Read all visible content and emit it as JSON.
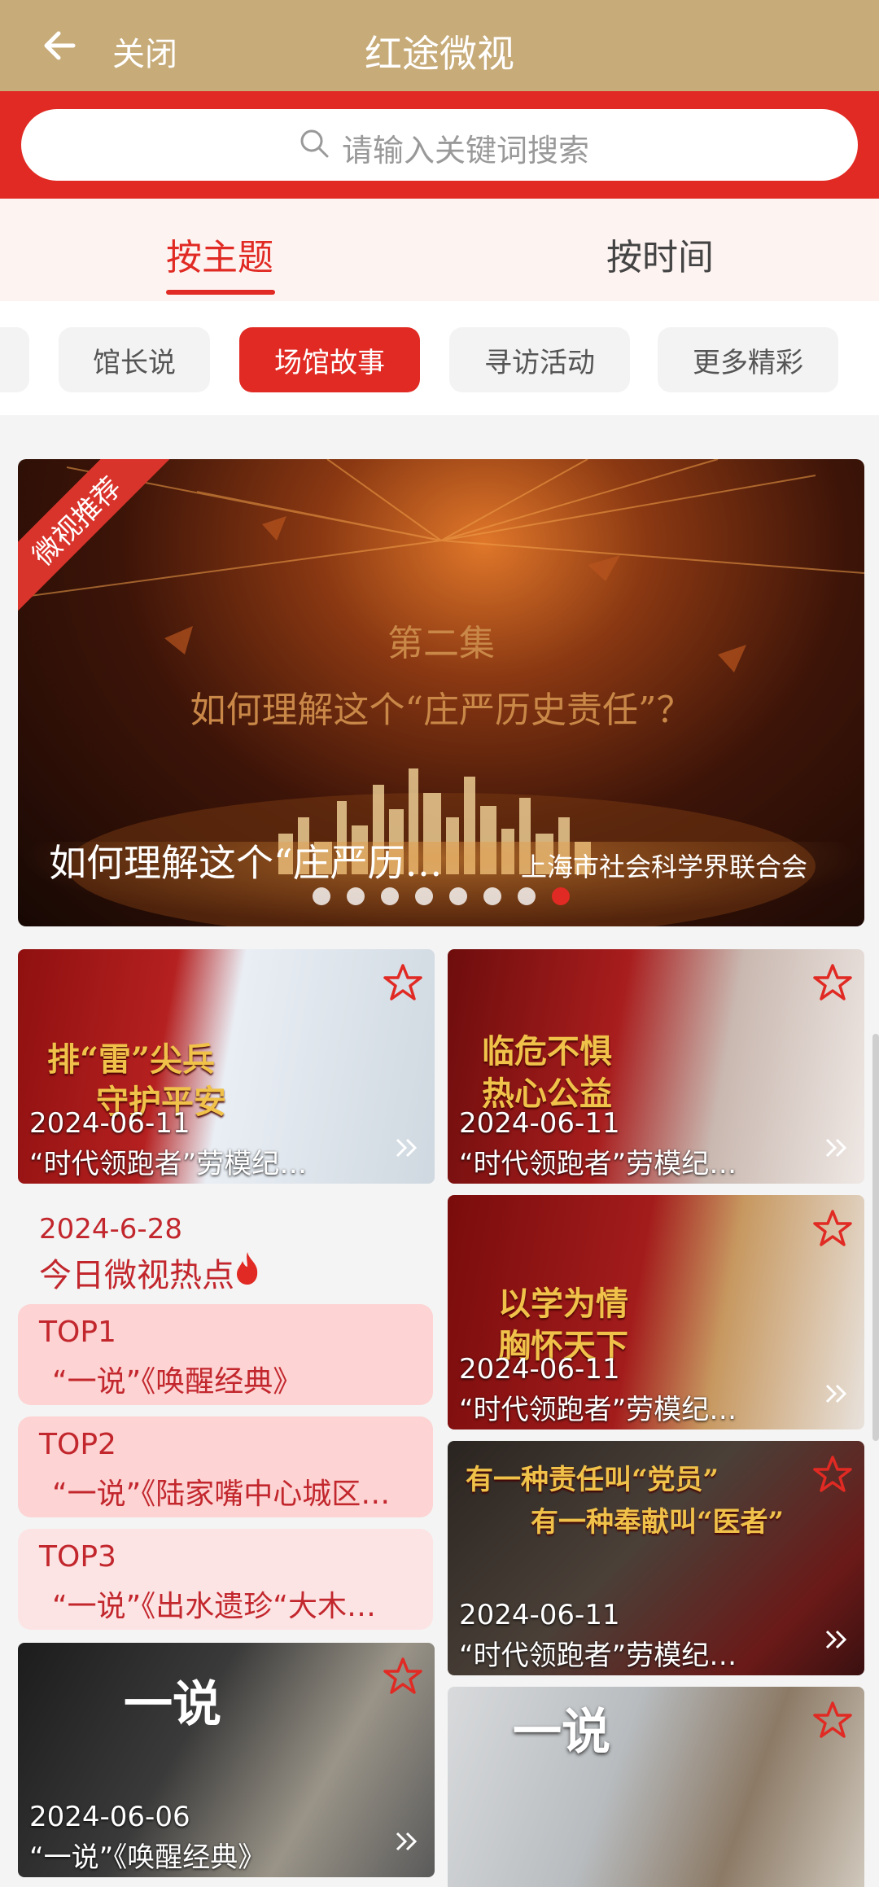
{
  "header": {
    "title": "红途微视",
    "close_label": "关闭"
  },
  "search": {
    "placeholder": "请输入关键词搜索"
  },
  "main_tabs": [
    {
      "label": "按主题",
      "active": true
    },
    {
      "label": "按时间",
      "active": false
    }
  ],
  "sub_tabs": [
    {
      "label": "馆长说",
      "active": false
    },
    {
      "label": "场馆故事",
      "active": true
    },
    {
      "label": "寻访活动",
      "active": false
    },
    {
      "label": "更多精彩",
      "active": false
    }
  ],
  "hero": {
    "ribbon": "微视推荐",
    "episode": "第二集",
    "question": "如何理解这个“庄严历史责任”？",
    "title": "如何理解这个“庄严历…",
    "source": "上海市社会科学界联合会",
    "page_count": 8,
    "active_page": 8
  },
  "cards": [
    {
      "date": "2024-06-11",
      "title": "“时代领跑者”劳模纪…",
      "caption": [
        "排“雷”尖兵",
        "守护平安"
      ]
    },
    {
      "date": "2024-06-11",
      "title": "“时代领跑者”劳模纪…",
      "caption": [
        "临危不惧",
        "热心公益"
      ]
    },
    {
      "date": "2024-06-11",
      "title": "“时代领跑者”劳模纪…",
      "caption": [
        "以学为情",
        "胸怀天下"
      ]
    },
    {
      "date": "2024-06-11",
      "title": "“时代领跑者”劳模纪…",
      "caption": [
        "有一种责任叫“党员”",
        "有一种奉献叫“医者”"
      ]
    },
    {
      "date": "2024-06-06",
      "title": "“一说”《唤醒经典》",
      "caption": [
        "一说"
      ]
    },
    {
      "date": "",
      "title": "",
      "caption": [
        "一说"
      ]
    }
  ],
  "hot": {
    "date": "2024-6-28",
    "title": "今日微视热点",
    "items": [
      {
        "rank": "TOP1",
        "name": "“一说”《唤醒经典》"
      },
      {
        "rank": "TOP2",
        "name": "“一说”《陆家嘴中心城区…"
      },
      {
        "rank": "TOP3",
        "name": "“一说”《出水遗珍“大木…"
      }
    ]
  },
  "colors": {
    "brand_red": "#e02a23",
    "header_gold": "#c7ab79",
    "hot_text": "#c2272d"
  }
}
